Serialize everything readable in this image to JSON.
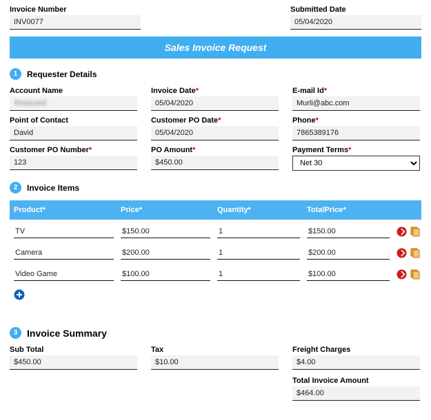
{
  "header": {
    "invoice_number_label": "Invoice Number",
    "invoice_number": "INV0077",
    "submitted_date_label": "Submitted Date",
    "submitted_date": "05/04/2020"
  },
  "banner_title": "Sales Invoice Request",
  "section1": {
    "num": "1",
    "title": "Requester Details",
    "account_name_label": "Account Name",
    "account_name": "Redacted",
    "invoice_date_label": "Invoice Date",
    "invoice_date": "05/04/2020",
    "email_label": "E-mail Id",
    "email": "Murli@abc.com",
    "poc_label": "Point of Contact",
    "poc": "David",
    "cust_po_date_label": "Customer PO Date",
    "cust_po_date": "05/04/2020",
    "phone_label": "Phone",
    "phone": "7865389176",
    "cust_po_num_label": "Customer PO Number",
    "cust_po_num": "123",
    "po_amount_label": "PO Amount",
    "po_amount": "$450.00",
    "payment_terms_label": "Payment Terms",
    "payment_terms": "Net 30"
  },
  "section2": {
    "num": "2",
    "title": "Invoice Items",
    "headers": {
      "product": "Product",
      "price": "Price",
      "qty": "Quantity",
      "tp": "TotalPrice"
    },
    "rows": [
      {
        "product": "TV",
        "price": "$150.00",
        "qty": "1",
        "tp": "$150.00"
      },
      {
        "product": "Camera",
        "price": "$200.00",
        "qty": "1",
        "tp": "$200.00"
      },
      {
        "product": "Video Game",
        "price": "$100.00",
        "qty": "1",
        "tp": "$100.00"
      }
    ]
  },
  "section3": {
    "num": "3",
    "title": "Invoice Summary",
    "subtotal_label": "Sub Total",
    "subtotal": "$450.00",
    "tax_label": "Tax",
    "tax": "$10.00",
    "freight_label": "Freight Charges",
    "freight": "$4.00",
    "total_label": "Total Invoice Amount",
    "total": "$464.00"
  },
  "chart_data": {
    "type": "table",
    "title": "Invoice Items",
    "columns": [
      "Product",
      "Price",
      "Quantity",
      "TotalPrice"
    ],
    "rows": [
      [
        "TV",
        150.0,
        1,
        150.0
      ],
      [
        "Camera",
        200.0,
        1,
        200.0
      ],
      [
        "Video Game",
        100.0,
        1,
        100.0
      ]
    ],
    "summary": {
      "sub_total": 450.0,
      "tax": 10.0,
      "freight": 4.0,
      "total": 464.0
    }
  }
}
